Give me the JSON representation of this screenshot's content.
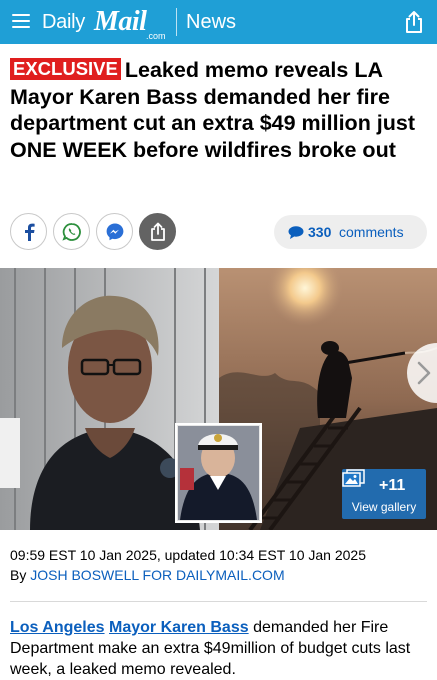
{
  "header": {
    "brand_daily": "Daily",
    "brand_mail": "Mail",
    "brand_com": ".com",
    "section": "News",
    "bg_color": "#1f9fd6"
  },
  "article": {
    "badge": "EXCLUSIVE",
    "headline": "Leaked memo reveals LA Mayor Karen Bass demanded her fire department cut an extra $49 million just ONE WEEK before wildfires broke out",
    "comments_count": "330",
    "comments_label": "comments",
    "timestamp": "09:59 EST 10 Jan 2025, updated 10:34 EST 10 Jan 2025",
    "byline_prefix": "By",
    "author": "JOSH BOSWELL FOR DAILYMAIL.COM",
    "body_link_1": "Los Angeles",
    "body_link_2": "Mayor Karen Bass",
    "body_text": "demanded her Fire Department make an extra $49million of budget cuts last week, a leaked memo revealed."
  },
  "social": {
    "icons": [
      "facebook-icon",
      "whatsapp-icon",
      "messenger-icon",
      "share-icon"
    ]
  },
  "gallery": {
    "count": "+11",
    "label": "View gallery"
  },
  "colors": {
    "accent_blue": "#1f9fd6",
    "link_blue": "#0b5fbd",
    "exclusive_red": "#e01e1e"
  }
}
